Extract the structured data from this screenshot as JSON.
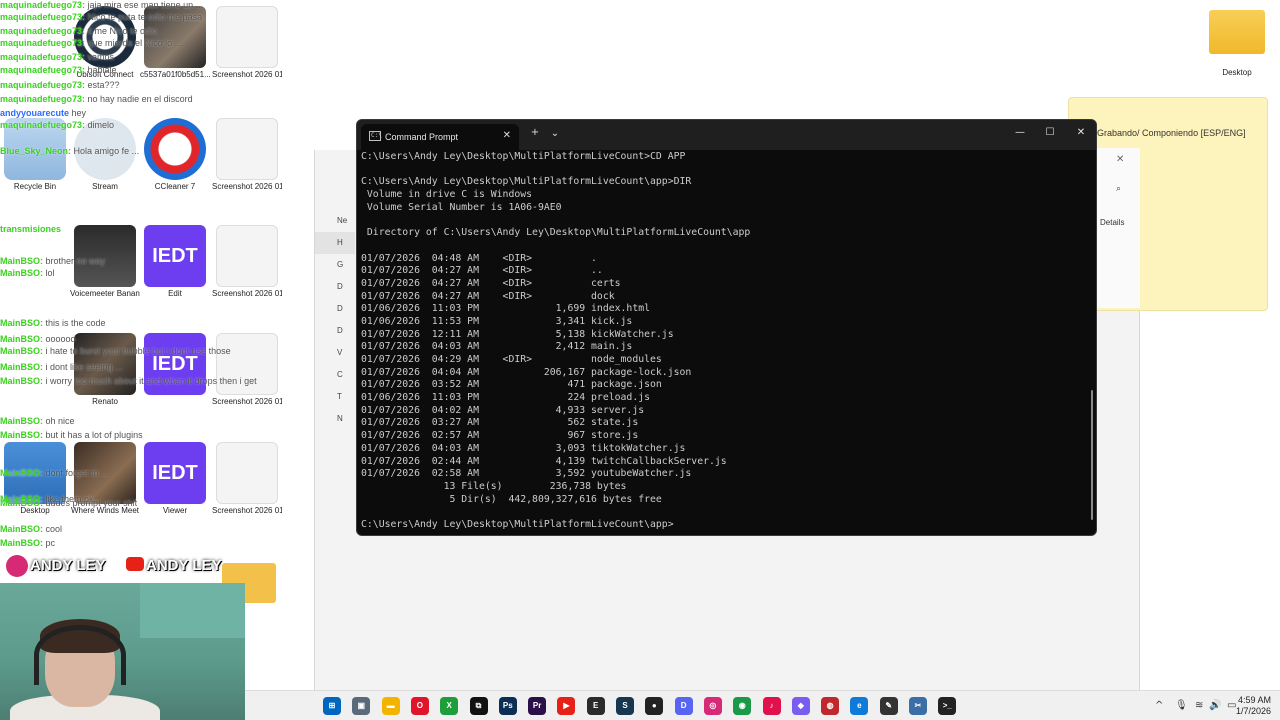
{
  "desktop": {
    "icons": [
      {
        "label": "Ubisoft Connect"
      },
      {
        "label": "c5537a01f0b5d51..."
      },
      {
        "label": "Screenshot 2026 01 ..."
      },
      {
        "label": "Recycle Bin"
      },
      {
        "label": "Stream"
      },
      {
        "label": "CCleaner 7"
      },
      {
        "label": "Screenshot 2026 01 ..."
      },
      {
        "label": "Voicemeeter Banana"
      },
      {
        "label": "Edit"
      },
      {
        "label": "Screenshot 2026 01 ..."
      },
      {
        "label": "Renato"
      },
      {
        "label": "Screenshot 2026 01 ..."
      },
      {
        "label": "Where Winds Meet"
      },
      {
        "label": "Viewer"
      },
      {
        "label": "Screenshot 2026 01 ..."
      },
      {
        "label": "Desktop"
      }
    ],
    "top_right_folder": "Desktop"
  },
  "chat": {
    "lines": [
      {
        "user": "maquinadefuego73:",
        "msg": "jaja mira ese man tiene un ..."
      },
      {
        "user": "maquinadefuego73:",
        "msg": "Nico te puta te odio me pasa"
      },
      {
        "user": "maquinadefuego73:",
        "msg": "ti me Nico te odio"
      },
      {
        "user": "maquinadefuego73:",
        "msg": "que mierda el Nico lo ..."
      },
      {
        "user": "maquinadefuego73:",
        "msg": "vamos"
      },
      {
        "user": "maquinadefuego73:",
        "msg": "hablale"
      },
      {
        "user": "maquinadefuego73:",
        "msg": "esta???"
      },
      {
        "user": "maquinadefuego73:",
        "msg": "no hay nadie en el discord"
      },
      {
        "user": "andyyouarecute",
        "msg": "hey"
      },
      {
        "user": "maquinadefuego73:",
        "msg": "dimelo"
      },
      {
        "user": "Blue_Sky_Neon:",
        "msg": "Hola amigo fe ..."
      },
      {
        "user": "transmisiones",
        "msg": ""
      },
      {
        "user": "MainBSO:",
        "msg": "brother no way"
      },
      {
        "user": "MainBSO:",
        "msg": "lol"
      },
      {
        "user": "MainBSO:",
        "msg": "oooooo"
      },
      {
        "user": "MainBSO:",
        "msg": "i hate to burst your bubble but i dont use those"
      },
      {
        "user": "MainBSO:",
        "msg": "i dont like seeing ..."
      },
      {
        "user": "MainBSO:",
        "msg": "i worry too much about it and when it drops then i get"
      },
      {
        "user": "MainBSO:",
        "msg": "this is the code"
      },
      {
        "user": "MainBSO:",
        "msg": "oh nice"
      },
      {
        "user": "MainBSO:",
        "msg": "but it has a lot of plugins"
      },
      {
        "user": "MainBSO:",
        "msg": "dudes prompt your shit"
      },
      {
        "user": "MainBSO:",
        "msg": "dont forget to ..."
      },
      {
        "user": "MainBSO:",
        "msg": "like them ok"
      },
      {
        "user": "MainBSO:",
        "msg": "cool"
      },
      {
        "user": "MainBSO:",
        "msg": "pc"
      }
    ]
  },
  "sticky_note": {
    "title": "Grabando/ Componiendo [ESP/ENG]"
  },
  "explorer": {
    "sidebar": [
      "Ne",
      "H",
      "G",
      "D",
      "D",
      "D",
      "V",
      "C",
      "T",
      "N"
    ],
    "details_label": "Details"
  },
  "terminal": {
    "tab_title": "Command Prompt",
    "tab_icon": "C:\\",
    "new_tab": "+",
    "dropdown": "⌄",
    "controls": {
      "minimize": "—",
      "maximize": "☐",
      "close": "✕"
    },
    "lines": [
      "C:\\Users\\Andy Ley\\Desktop\\MultiPlatformLiveCount>CD APP",
      "",
      "C:\\Users\\Andy Ley\\Desktop\\MultiPlatformLiveCount\\app>DIR",
      " Volume in drive C is Windows",
      " Volume Serial Number is 1A06-9AE0",
      "",
      " Directory of C:\\Users\\Andy Ley\\Desktop\\MultiPlatformLiveCount\\app",
      "",
      "01/07/2026  04:48 AM    <DIR>          .",
      "01/07/2026  04:27 AM    <DIR>          ..",
      "01/07/2026  04:27 AM    <DIR>          certs",
      "01/07/2026  04:27 AM    <DIR>          dock",
      "01/06/2026  11:03 PM             1,699 index.html",
      "01/06/2026  11:53 PM             3,341 kick.js",
      "01/07/2026  12:11 AM             5,138 kickWatcher.js",
      "01/07/2026  04:03 AM             2,412 main.js",
      "01/07/2026  04:29 AM    <DIR>          node_modules",
      "01/07/2026  04:04 AM           206,167 package-lock.json",
      "01/07/2026  03:52 AM               471 package.json",
      "01/06/2026  11:03 PM               224 preload.js",
      "01/07/2026  04:02 AM             4,933 server.js",
      "01/07/2026  03:27 AM               562 state.js",
      "01/07/2026  02:57 AM               967 store.js",
      "01/07/2026  04:03 AM             3,093 tiktokWatcher.js",
      "01/07/2026  02:44 AM             4,139 twitchCallbackServer.js",
      "01/07/2026  02:58 AM             3,592 youtubeWatcher.js",
      "              13 File(s)        236,738 bytes",
      "               5 Dir(s)  442,809,327,616 bytes free",
      "",
      "C:\\Users\\Andy Ley\\Desktop\\MultiPlatformLiveCount\\app>"
    ]
  },
  "stream_overlay": {
    "brand_left": "ANDY LEY",
    "brand_right": "ANDY LEY",
    "iedt": "IEDT"
  },
  "taskbar": {
    "apps": [
      {
        "name": "start-icon",
        "glyph": "⊞",
        "color": "#0067c0"
      },
      {
        "name": "image-viewer-icon",
        "glyph": "▣",
        "color": "#5b6a7a"
      },
      {
        "name": "file-explorer-icon",
        "glyph": "▬",
        "color": "#f3b400"
      },
      {
        "name": "opera-icon",
        "glyph": "O",
        "color": "#e0142b"
      },
      {
        "name": "xbox-icon",
        "glyph": "X",
        "color": "#1e9e3a"
      },
      {
        "name": "capcut-icon",
        "glyph": "⧉",
        "color": "#111111"
      },
      {
        "name": "photoshop-icon",
        "glyph": "Ps",
        "color": "#0b2e55"
      },
      {
        "name": "premiere-icon",
        "glyph": "Pr",
        "color": "#2a0f48"
      },
      {
        "name": "youtube-music-icon",
        "glyph": "▶",
        "color": "#e62117"
      },
      {
        "name": "epic-games-icon",
        "glyph": "E",
        "color": "#2b2b2b"
      },
      {
        "name": "steam-icon",
        "glyph": "S",
        "color": "#17364f"
      },
      {
        "name": "obs-icon",
        "glyph": "●",
        "color": "#222222"
      },
      {
        "name": "discord-icon",
        "glyph": "D",
        "color": "#5865f2"
      },
      {
        "name": "instagram-icon",
        "glyph": "◎",
        "color": "#d62976"
      },
      {
        "name": "chrome-icon",
        "glyph": "◉",
        "color": "#1a9a48"
      },
      {
        "name": "tiktok-icon",
        "glyph": "♪",
        "color": "#e0114d"
      },
      {
        "name": "streamer-bot-icon",
        "glyph": "◆",
        "color": "#7a5cf0"
      },
      {
        "name": "record-icon",
        "glyph": "◍",
        "color": "#c0282d"
      },
      {
        "name": "edge-icon",
        "glyph": "e",
        "color": "#0f7bd8"
      },
      {
        "name": "notes-icon",
        "glyph": "✎",
        "color": "#333333"
      },
      {
        "name": "snipping-icon",
        "glyph": "✂",
        "color": "#3a6ea5"
      },
      {
        "name": "terminal-icon",
        "glyph": ">_",
        "color": "#222222"
      }
    ],
    "tray": {
      "chevron": "^",
      "mic": "🎙",
      "wifi": "≋",
      "volume": "🔊",
      "battery": "▭",
      "time": "4:59 AM",
      "date": "1/7/2026"
    }
  }
}
